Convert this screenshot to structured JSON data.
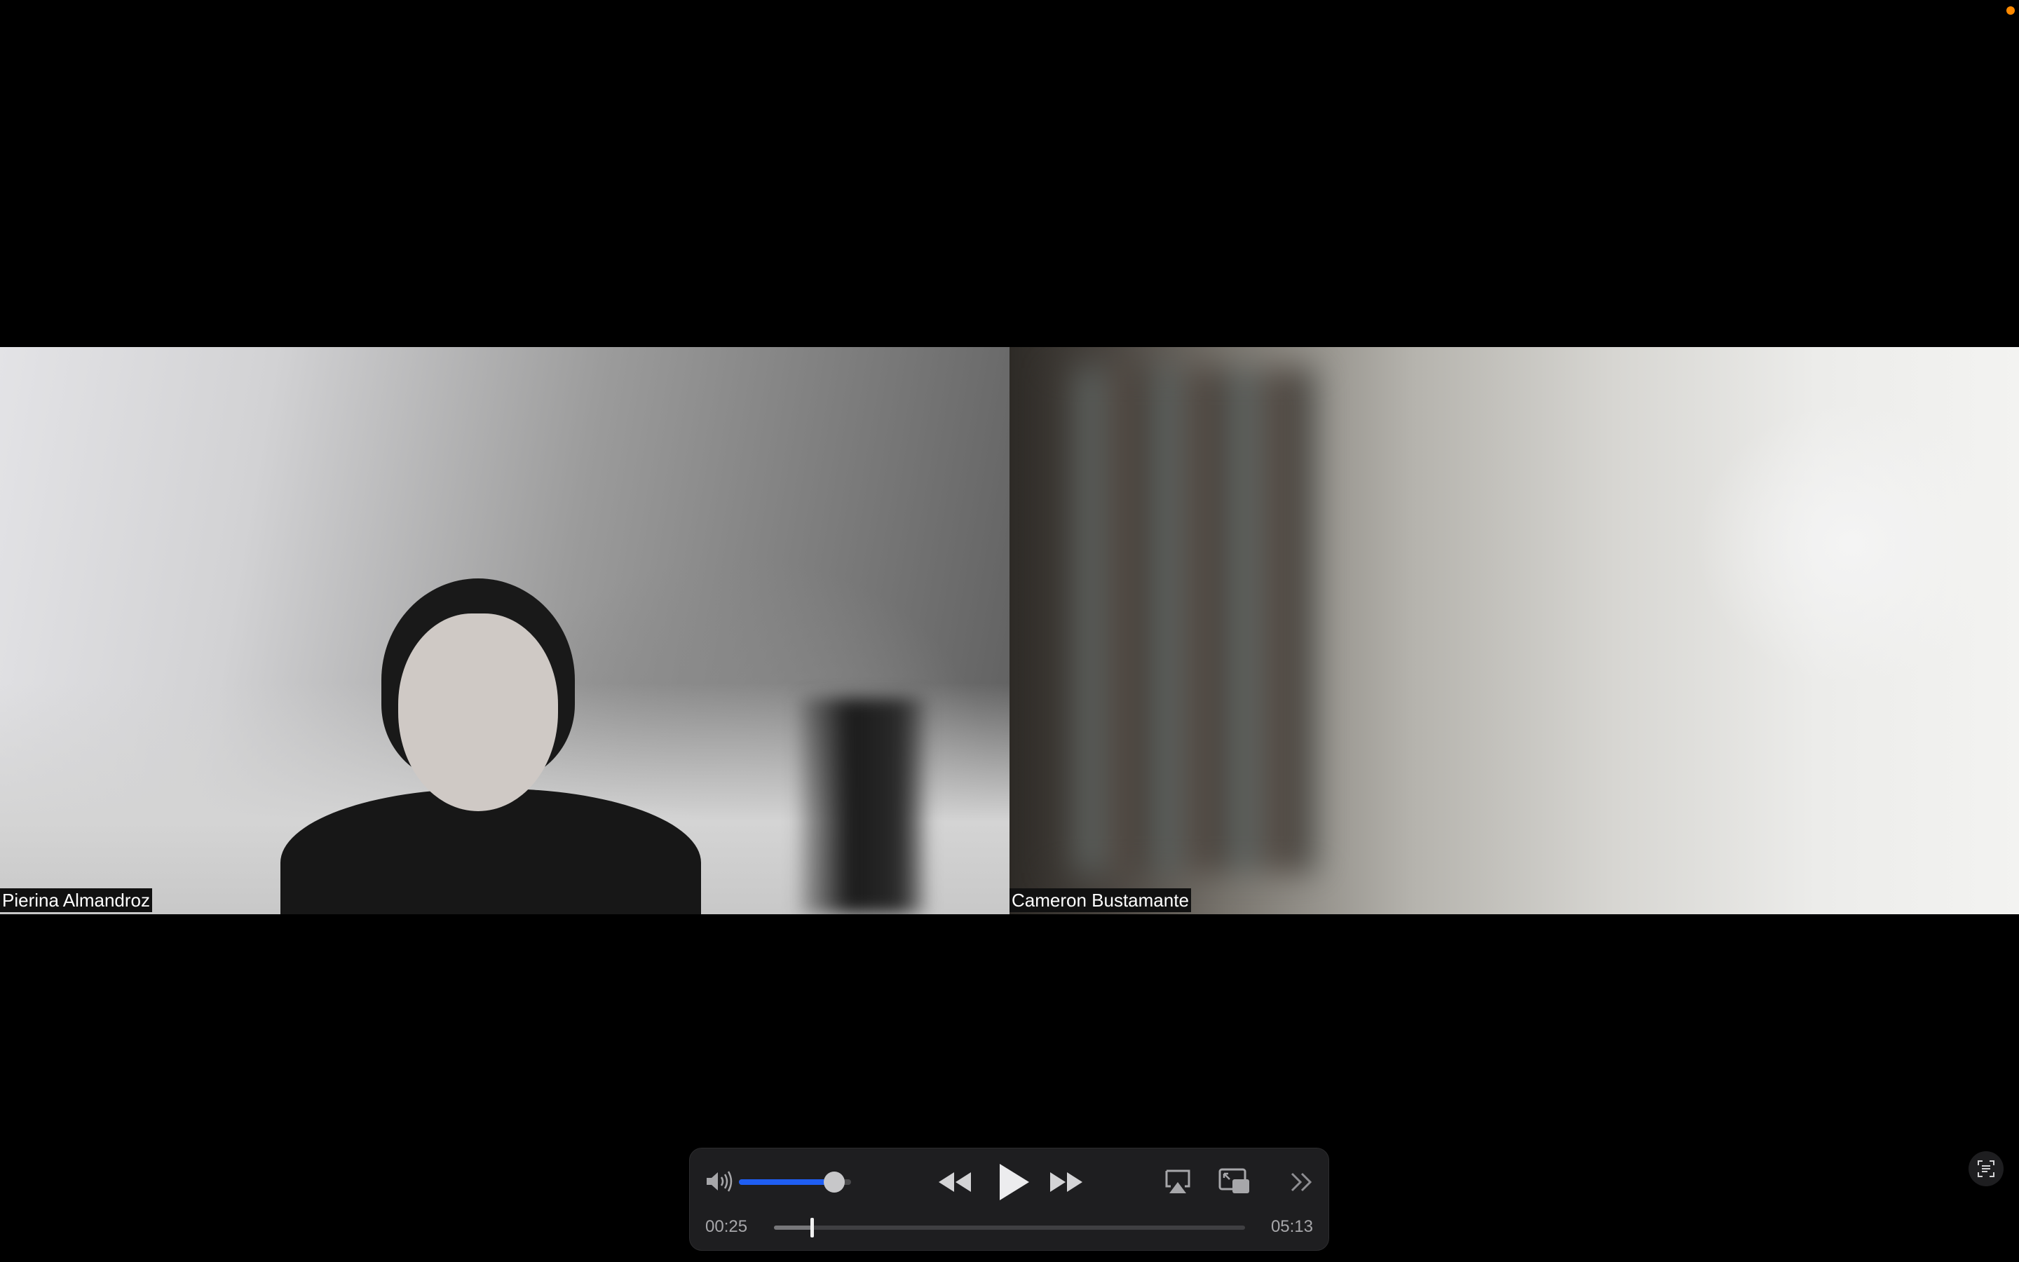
{
  "window": {
    "recording_indicator_color": "#ff8a00"
  },
  "participants": [
    {
      "name": "Pierina Almandroz"
    },
    {
      "name": "Cameron Bustamante"
    }
  ],
  "player": {
    "volume_level": 0.85,
    "progress_fraction": 0.08,
    "current_time": "00:25",
    "total_time": "05:13",
    "accent_color": "#1f5ef2",
    "icons": {
      "volume": "speaker-volume-icon",
      "rewind": "rewind-icon",
      "play": "play-icon",
      "fast_forward": "fast-forward-icon",
      "airplay": "airplay-icon",
      "pip": "picture-in-picture-icon",
      "more": "more-chevrons-icon"
    }
  },
  "overlay": {
    "captions_icon": "live-text-icon"
  }
}
